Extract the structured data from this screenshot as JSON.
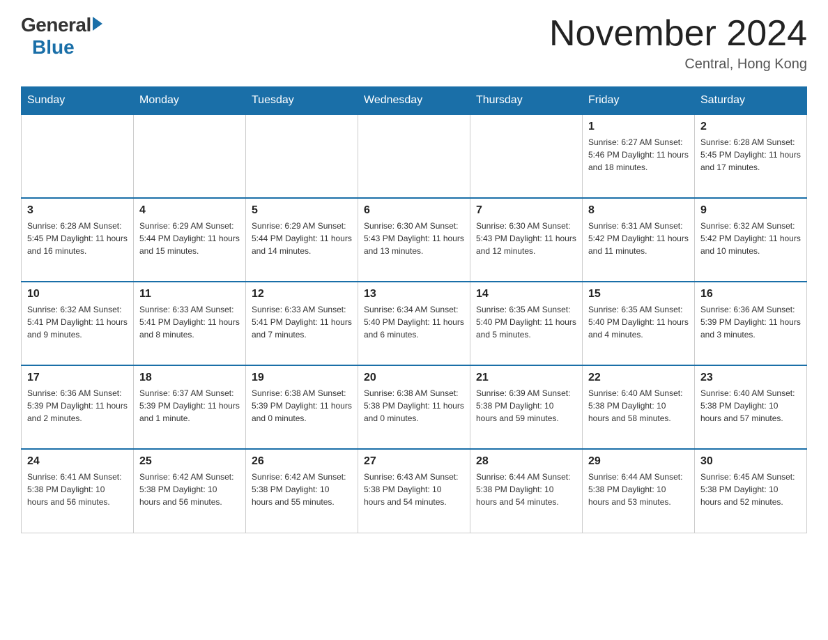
{
  "header": {
    "logo_general": "General",
    "logo_blue": "Blue",
    "month_title": "November 2024",
    "subtitle": "Central, Hong Kong"
  },
  "weekdays": [
    "Sunday",
    "Monday",
    "Tuesday",
    "Wednesday",
    "Thursday",
    "Friday",
    "Saturday"
  ],
  "weeks": [
    [
      {
        "day": "",
        "info": ""
      },
      {
        "day": "",
        "info": ""
      },
      {
        "day": "",
        "info": ""
      },
      {
        "day": "",
        "info": ""
      },
      {
        "day": "",
        "info": ""
      },
      {
        "day": "1",
        "info": "Sunrise: 6:27 AM\nSunset: 5:46 PM\nDaylight: 11 hours\nand 18 minutes."
      },
      {
        "day": "2",
        "info": "Sunrise: 6:28 AM\nSunset: 5:45 PM\nDaylight: 11 hours\nand 17 minutes."
      }
    ],
    [
      {
        "day": "3",
        "info": "Sunrise: 6:28 AM\nSunset: 5:45 PM\nDaylight: 11 hours\nand 16 minutes."
      },
      {
        "day": "4",
        "info": "Sunrise: 6:29 AM\nSunset: 5:44 PM\nDaylight: 11 hours\nand 15 minutes."
      },
      {
        "day": "5",
        "info": "Sunrise: 6:29 AM\nSunset: 5:44 PM\nDaylight: 11 hours\nand 14 minutes."
      },
      {
        "day": "6",
        "info": "Sunrise: 6:30 AM\nSunset: 5:43 PM\nDaylight: 11 hours\nand 13 minutes."
      },
      {
        "day": "7",
        "info": "Sunrise: 6:30 AM\nSunset: 5:43 PM\nDaylight: 11 hours\nand 12 minutes."
      },
      {
        "day": "8",
        "info": "Sunrise: 6:31 AM\nSunset: 5:42 PM\nDaylight: 11 hours\nand 11 minutes."
      },
      {
        "day": "9",
        "info": "Sunrise: 6:32 AM\nSunset: 5:42 PM\nDaylight: 11 hours\nand 10 minutes."
      }
    ],
    [
      {
        "day": "10",
        "info": "Sunrise: 6:32 AM\nSunset: 5:41 PM\nDaylight: 11 hours\nand 9 minutes."
      },
      {
        "day": "11",
        "info": "Sunrise: 6:33 AM\nSunset: 5:41 PM\nDaylight: 11 hours\nand 8 minutes."
      },
      {
        "day": "12",
        "info": "Sunrise: 6:33 AM\nSunset: 5:41 PM\nDaylight: 11 hours\nand 7 minutes."
      },
      {
        "day": "13",
        "info": "Sunrise: 6:34 AM\nSunset: 5:40 PM\nDaylight: 11 hours\nand 6 minutes."
      },
      {
        "day": "14",
        "info": "Sunrise: 6:35 AM\nSunset: 5:40 PM\nDaylight: 11 hours\nand 5 minutes."
      },
      {
        "day": "15",
        "info": "Sunrise: 6:35 AM\nSunset: 5:40 PM\nDaylight: 11 hours\nand 4 minutes."
      },
      {
        "day": "16",
        "info": "Sunrise: 6:36 AM\nSunset: 5:39 PM\nDaylight: 11 hours\nand 3 minutes."
      }
    ],
    [
      {
        "day": "17",
        "info": "Sunrise: 6:36 AM\nSunset: 5:39 PM\nDaylight: 11 hours\nand 2 minutes."
      },
      {
        "day": "18",
        "info": "Sunrise: 6:37 AM\nSunset: 5:39 PM\nDaylight: 11 hours\nand 1 minute."
      },
      {
        "day": "19",
        "info": "Sunrise: 6:38 AM\nSunset: 5:39 PM\nDaylight: 11 hours\nand 0 minutes."
      },
      {
        "day": "20",
        "info": "Sunrise: 6:38 AM\nSunset: 5:38 PM\nDaylight: 11 hours\nand 0 minutes."
      },
      {
        "day": "21",
        "info": "Sunrise: 6:39 AM\nSunset: 5:38 PM\nDaylight: 10 hours\nand 59 minutes."
      },
      {
        "day": "22",
        "info": "Sunrise: 6:40 AM\nSunset: 5:38 PM\nDaylight: 10 hours\nand 58 minutes."
      },
      {
        "day": "23",
        "info": "Sunrise: 6:40 AM\nSunset: 5:38 PM\nDaylight: 10 hours\nand 57 minutes."
      }
    ],
    [
      {
        "day": "24",
        "info": "Sunrise: 6:41 AM\nSunset: 5:38 PM\nDaylight: 10 hours\nand 56 minutes."
      },
      {
        "day": "25",
        "info": "Sunrise: 6:42 AM\nSunset: 5:38 PM\nDaylight: 10 hours\nand 56 minutes."
      },
      {
        "day": "26",
        "info": "Sunrise: 6:42 AM\nSunset: 5:38 PM\nDaylight: 10 hours\nand 55 minutes."
      },
      {
        "day": "27",
        "info": "Sunrise: 6:43 AM\nSunset: 5:38 PM\nDaylight: 10 hours\nand 54 minutes."
      },
      {
        "day": "28",
        "info": "Sunrise: 6:44 AM\nSunset: 5:38 PM\nDaylight: 10 hours\nand 54 minutes."
      },
      {
        "day": "29",
        "info": "Sunrise: 6:44 AM\nSunset: 5:38 PM\nDaylight: 10 hours\nand 53 minutes."
      },
      {
        "day": "30",
        "info": "Sunrise: 6:45 AM\nSunset: 5:38 PM\nDaylight: 10 hours\nand 52 minutes."
      }
    ]
  ]
}
